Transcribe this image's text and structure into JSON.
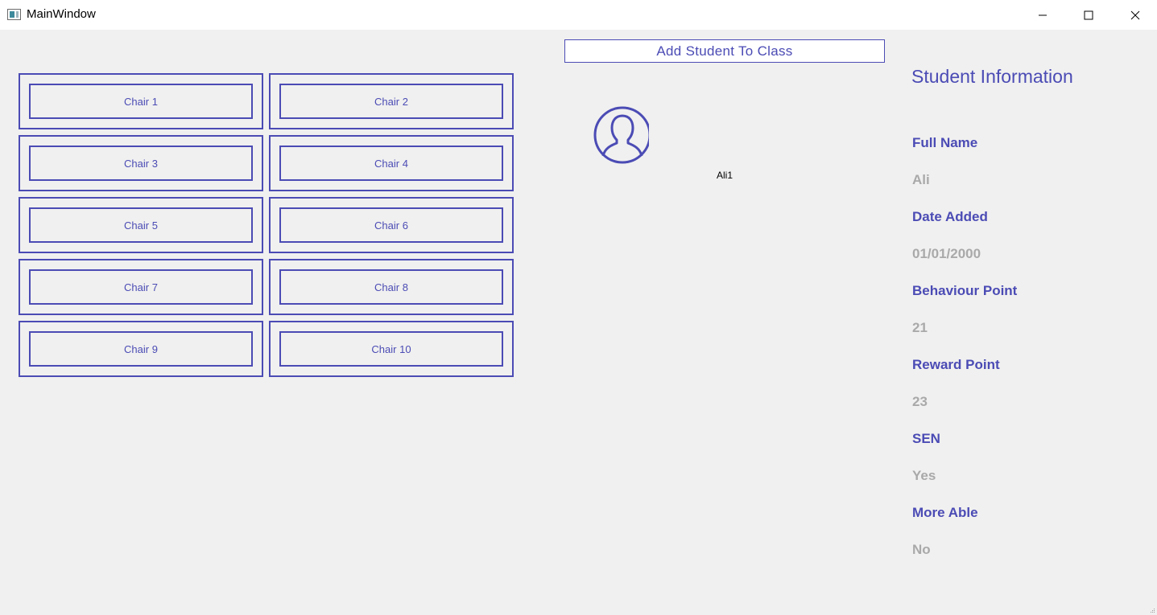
{
  "window": {
    "title": "MainWindow",
    "icon": "app-window-icon",
    "controls": [
      "minimize-icon",
      "maximize-icon",
      "close-icon"
    ]
  },
  "chairs": [
    {
      "label": "Chair 1"
    },
    {
      "label": "Chair 2"
    },
    {
      "label": "Chair 3"
    },
    {
      "label": "Chair 4"
    },
    {
      "label": "Chair 5"
    },
    {
      "label": "Chair 6"
    },
    {
      "label": "Chair 7"
    },
    {
      "label": "Chair 8"
    },
    {
      "label": "Chair 9"
    },
    {
      "label": "Chair 10"
    }
  ],
  "toolbar": {
    "add_student_label": "Add Student To Class"
  },
  "student_card": {
    "icon": "user-avatar-icon",
    "name": "Ali1"
  },
  "info": {
    "title": "Student Information",
    "fields": [
      {
        "label": "Full Name",
        "value": "Ali"
      },
      {
        "label": "Date Added",
        "value": "01/01/2000"
      },
      {
        "label": "Behaviour Point",
        "value": "21"
      },
      {
        "label": "Reward Point",
        "value": "23"
      },
      {
        "label": "SEN",
        "value": "Yes"
      },
      {
        "label": "More Able",
        "value": "No"
      }
    ]
  },
  "colors": {
    "accent": "#4b4bb5",
    "value_text": "#a9a9a9",
    "background": "#f0f0f0"
  }
}
